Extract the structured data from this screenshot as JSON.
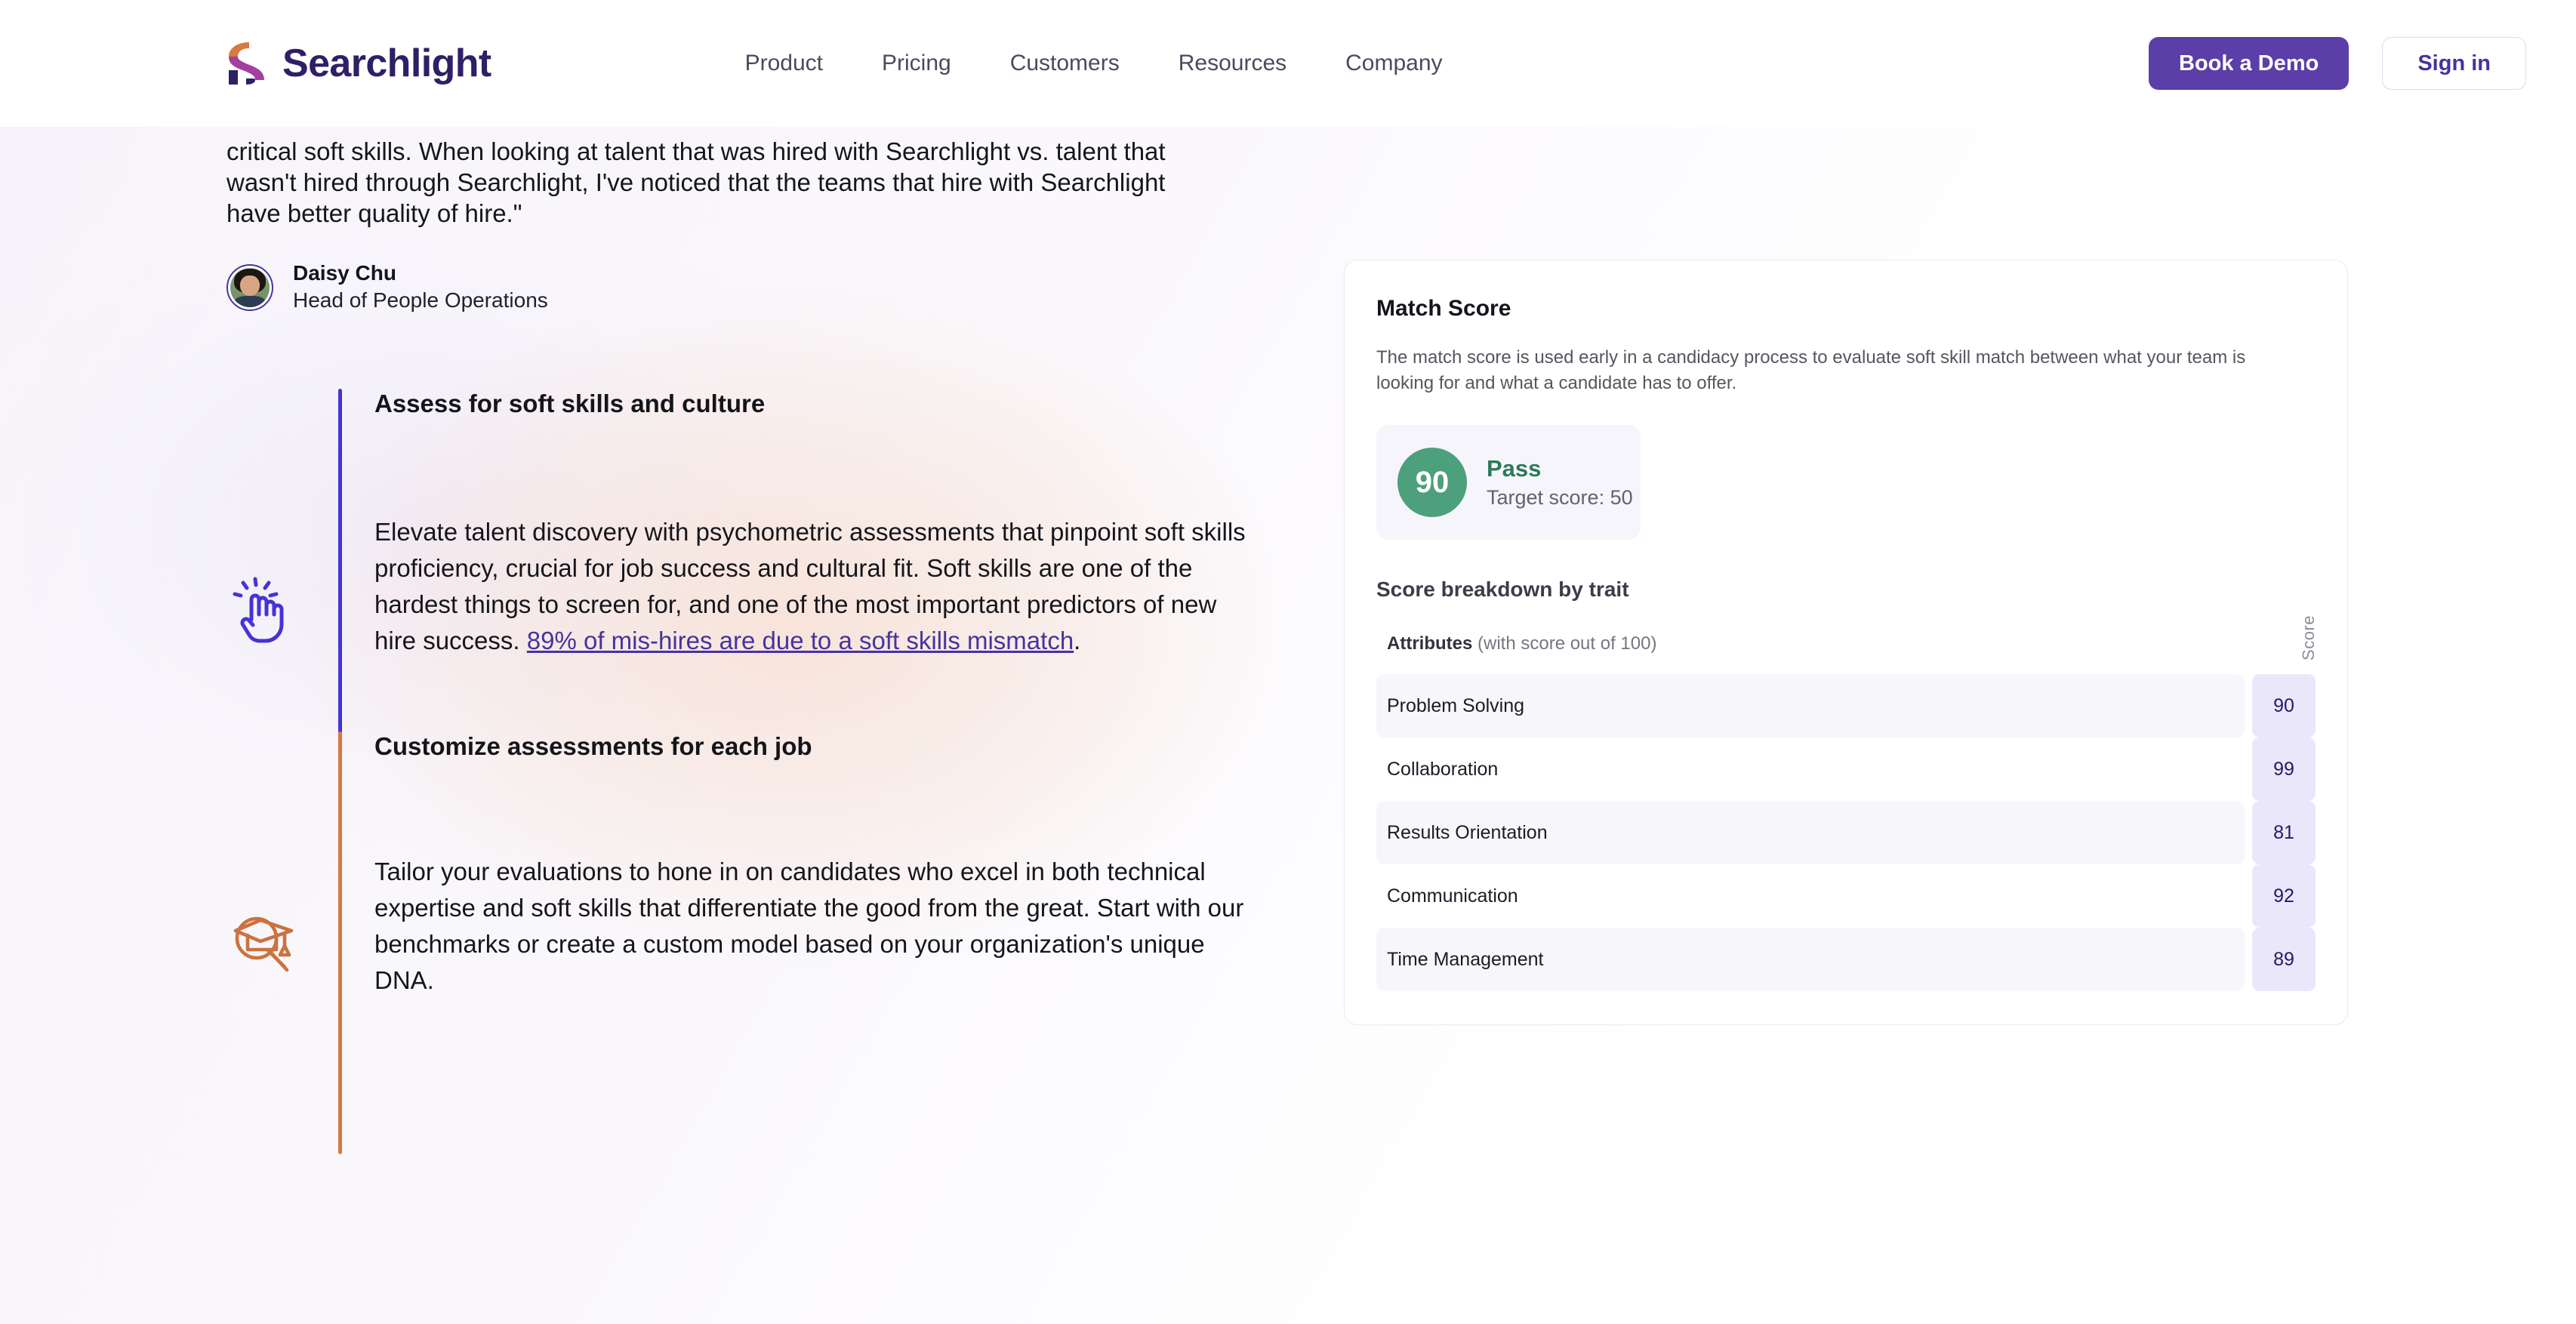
{
  "brand": {
    "name": "Searchlight",
    "logo_colors": {
      "orange": "#d8793f",
      "magenta": "#a43fa0",
      "navy": "#2e1f67"
    }
  },
  "header": {
    "nav": [
      {
        "label": "Product"
      },
      {
        "label": "Pricing"
      },
      {
        "label": "Customers"
      },
      {
        "label": "Resources"
      },
      {
        "label": "Company"
      }
    ],
    "cta_primary": "Book a Demo",
    "cta_secondary": "Sign in"
  },
  "testimonial": {
    "quote": "critical soft skills. When looking at talent that was hired with Searchlight vs. talent that wasn't hired through Searchlight, I've noticed that the teams that hire with Searchlight have better quality of hire.\"",
    "author_name": "Daisy Chu",
    "author_role": "Head of People Operations"
  },
  "features": [
    {
      "icon": "tapping-hand-icon",
      "accent": "#4633d6",
      "title": "Assess for soft skills and culture",
      "body_before_link": "Elevate talent discovery with psychometric assessments that pinpoint soft skills proficiency, crucial for job success and cultural fit. Soft skills are one of the hardest things to screen for, and one of the most important predictors of new hire success. ",
      "link_text": "89% of mis-hires are due to a soft skills mismatch",
      "body_after_link": "."
    },
    {
      "icon": "graduation-cap-search-icon",
      "accent": "#d8793f",
      "title": "Customize assessments for each job",
      "body_before_link": "Tailor your evaluations to hone in on candidates who excel in both technical expertise and soft skills that differentiate the good from the great. Start with our benchmarks or create a custom model based on your organization's unique DNA.",
      "link_text": "",
      "body_after_link": ""
    }
  ],
  "match_score_card": {
    "title": "Match Score",
    "description": "The match score is used early in a candidacy process to evaluate soft skill match between what your team is looking for and what a candidate has to offer.",
    "score_value": "90",
    "verdict": "Pass",
    "target_label": "Target score: 50",
    "breakdown_title": "Score breakdown by trait",
    "attributes_header_bold": "Attributes",
    "attributes_header_note": " (with score out of 100)",
    "score_column_label": "Score",
    "colors": {
      "score_circle": "#4ca07c",
      "verdict_text": "#2c7a5a",
      "chip_bg": "#eae7fb",
      "chip_text": "#241a5e"
    }
  },
  "chart_data": {
    "type": "bar",
    "title": "Score breakdown by trait",
    "xlabel": "Attributes (with score out of 100)",
    "ylabel": "Score",
    "categories": [
      "Problem Solving",
      "Collaboration",
      "Results Orientation",
      "Communication",
      "Time Management"
    ],
    "values": [
      90,
      99,
      81,
      92,
      89
    ],
    "ylim": [
      0,
      100
    ],
    "overall_score": 90,
    "target_score": 50,
    "verdict": "Pass"
  }
}
